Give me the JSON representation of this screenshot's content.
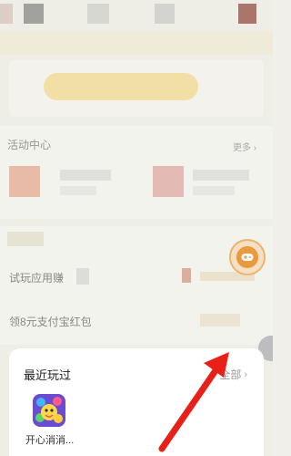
{
  "background": {
    "section_title": "活动中心",
    "more_label": "更多",
    "list_items": [
      "试玩应用赚",
      "领8元支付宝红包"
    ]
  },
  "sheet": {
    "title": "最近玩过",
    "all_label": "全部",
    "chevron": "›",
    "games": [
      {
        "name": "开心消消...",
        "icon": "happy-match-game-icon"
      }
    ]
  },
  "colors": {
    "accent_yellow": "#f7dc87",
    "annotation_arrow": "#e8201a",
    "float_button": "#e79a3e"
  }
}
